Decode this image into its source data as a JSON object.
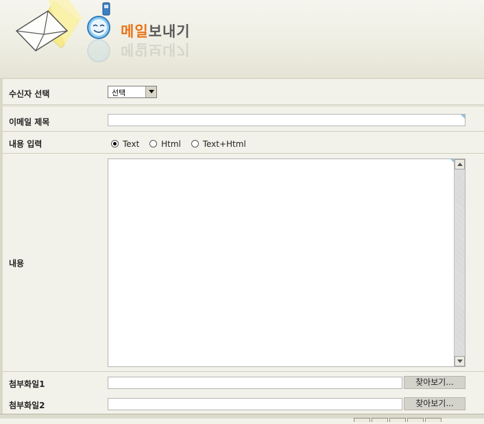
{
  "header": {
    "title_accent": "메일",
    "title_rest": "보내기"
  },
  "form": {
    "recipient": {
      "label": "수신자 선택",
      "selected": "선택"
    },
    "subject": {
      "label": "이메일 제목",
      "value": ""
    },
    "content_type": {
      "label": "내용 입력",
      "options": [
        "Text",
        "Html",
        "Text+Html"
      ],
      "selected": "Text"
    },
    "content": {
      "label": "내용",
      "value": ""
    },
    "attachment1": {
      "label": "첨부화일1",
      "button": "찾아보기..."
    },
    "attachment2": {
      "label": "첨부화일2",
      "button": "찾아보기..."
    }
  },
  "icons": {
    "envelope": "envelope-icon",
    "mascot": "mascot-icon"
  },
  "colors": {
    "accent": "#e8741a",
    "title_gray": "#5a5a5a",
    "background": "#f3f2ea"
  }
}
